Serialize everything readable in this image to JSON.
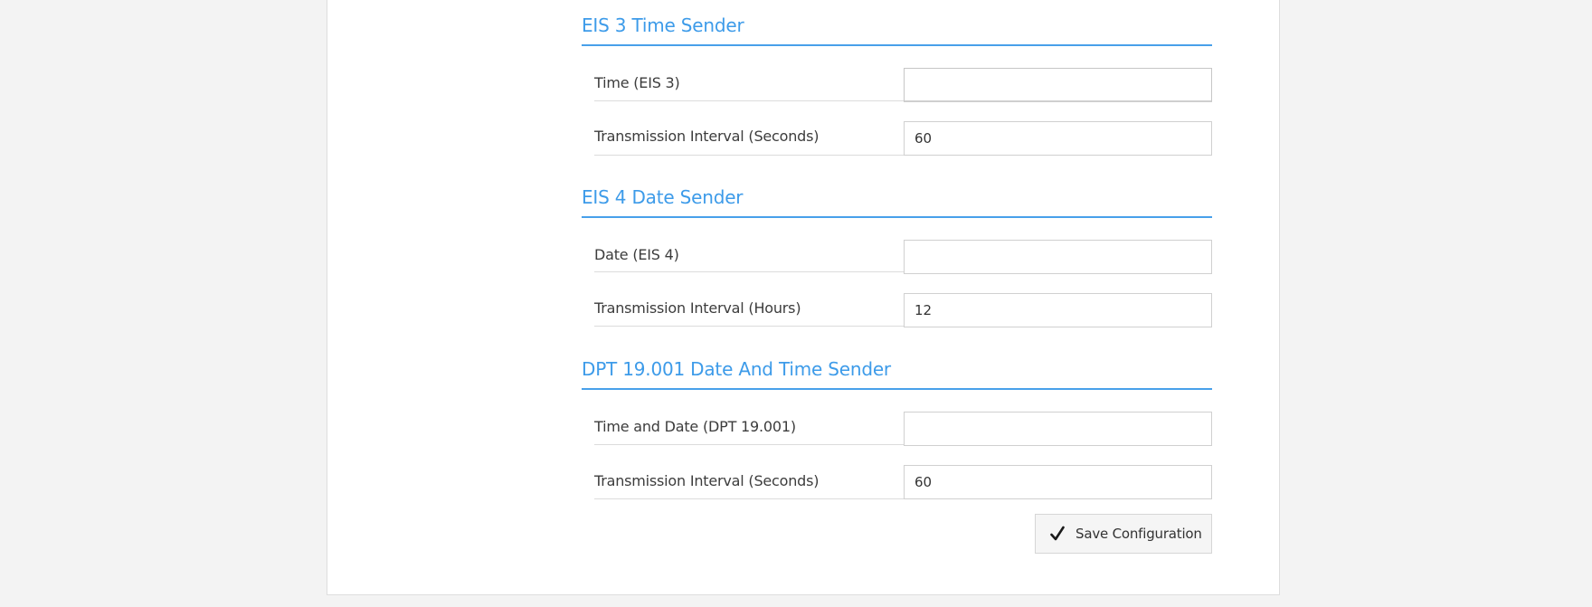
{
  "sections": [
    {
      "title": "EIS 3 Time Sender",
      "fields": [
        {
          "label": "Time (EIS 3)",
          "value": ""
        },
        {
          "label": "Transmission Interval (Seconds)",
          "value": "60"
        }
      ]
    },
    {
      "title": "EIS 4 Date Sender",
      "fields": [
        {
          "label": "Date (EIS 4)",
          "value": ""
        },
        {
          "label": "Transmission Interval (Hours)",
          "value": "12"
        }
      ]
    },
    {
      "title": "DPT 19.001 Date And Time Sender",
      "fields": [
        {
          "label": "Time and Date (DPT 19.001)",
          "value": ""
        },
        {
          "label": "Transmission Interval (Seconds)",
          "value": "60"
        }
      ]
    }
  ],
  "save_button": {
    "label": "Save Configuration",
    "icon": "checkmark-icon"
  },
  "colors": {
    "accent": "#3d9be9",
    "background": "#f3f3f3",
    "panel": "#ffffff"
  }
}
